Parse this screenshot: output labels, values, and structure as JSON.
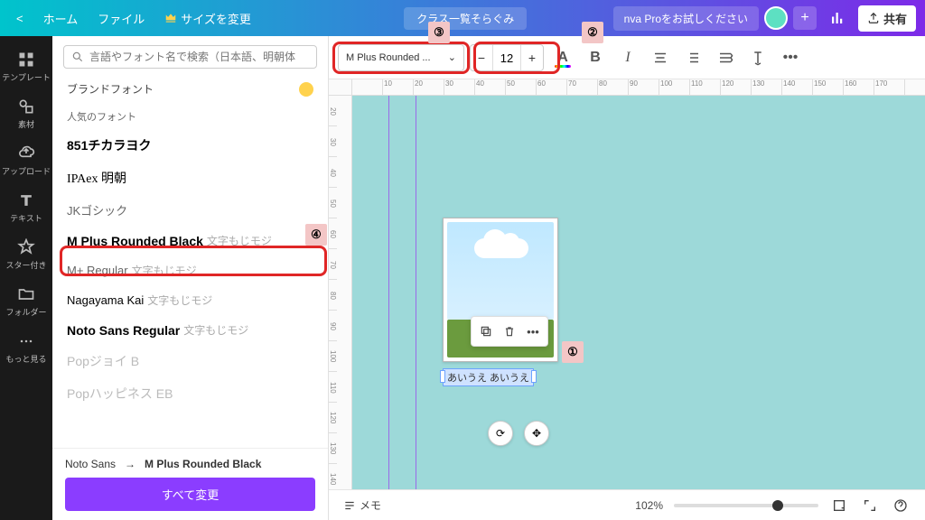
{
  "top": {
    "home": "ホーム",
    "file": "ファイル",
    "resize": "サイズを変更",
    "doc_title": "クラス一覧そらぐみ",
    "pro": "nva Proをお試しください",
    "share": "共有"
  },
  "rail": {
    "template": "テンプレート",
    "elements": "素材",
    "upload": "アップロード",
    "text": "テキスト",
    "star": "スター付き",
    "folder": "フォルダー",
    "more": "もっと見る"
  },
  "panel": {
    "search_placeholder": "言語やフォント名で検索（日本語、明朝体",
    "brand_fonts": "ブランドフォント",
    "popular": "人気のフォント",
    "fonts": {
      "f1": "851チカラヨク",
      "f2": "IPAex 明朝",
      "f3": "JKゴシック",
      "f4": "M Plus Rounded Black",
      "f4_suffix": "文字もじモジ",
      "f5": "M+ Regular",
      "f5_suffix": "文字もじモジ",
      "f6": "Nagayama Kai",
      "f6_suffix": "文字もじモジ",
      "f7": "Noto Sans Regular",
      "f7_suffix": "文字もじモジ",
      "f8": "Popジョイ B",
      "f9": "Popハッピネス EB"
    },
    "replace_from": "Noto Sans",
    "replace_to": "M Plus Rounded Black",
    "replace_btn": "すべて変更"
  },
  "toolbar": {
    "font_name": "M Plus Rounded ...",
    "size": "12"
  },
  "canvas": {
    "text_content": "あいうえ あいうえ"
  },
  "bottom": {
    "notes": "メモ",
    "zoom": "102%"
  },
  "callouts": {
    "n1": "①",
    "n2": "②",
    "n3": "③",
    "n4": "④"
  },
  "ruler_h": [
    "",
    "10",
    "20",
    "30",
    "40",
    "50",
    "60",
    "70",
    "80",
    "90",
    "100",
    "110",
    "120",
    "130",
    "140",
    "150",
    "160",
    "170"
  ],
  "ruler_v": [
    "20",
    "30",
    "40",
    "50",
    "60",
    "70",
    "80",
    "90",
    "100",
    "110",
    "120",
    "130",
    "140"
  ]
}
